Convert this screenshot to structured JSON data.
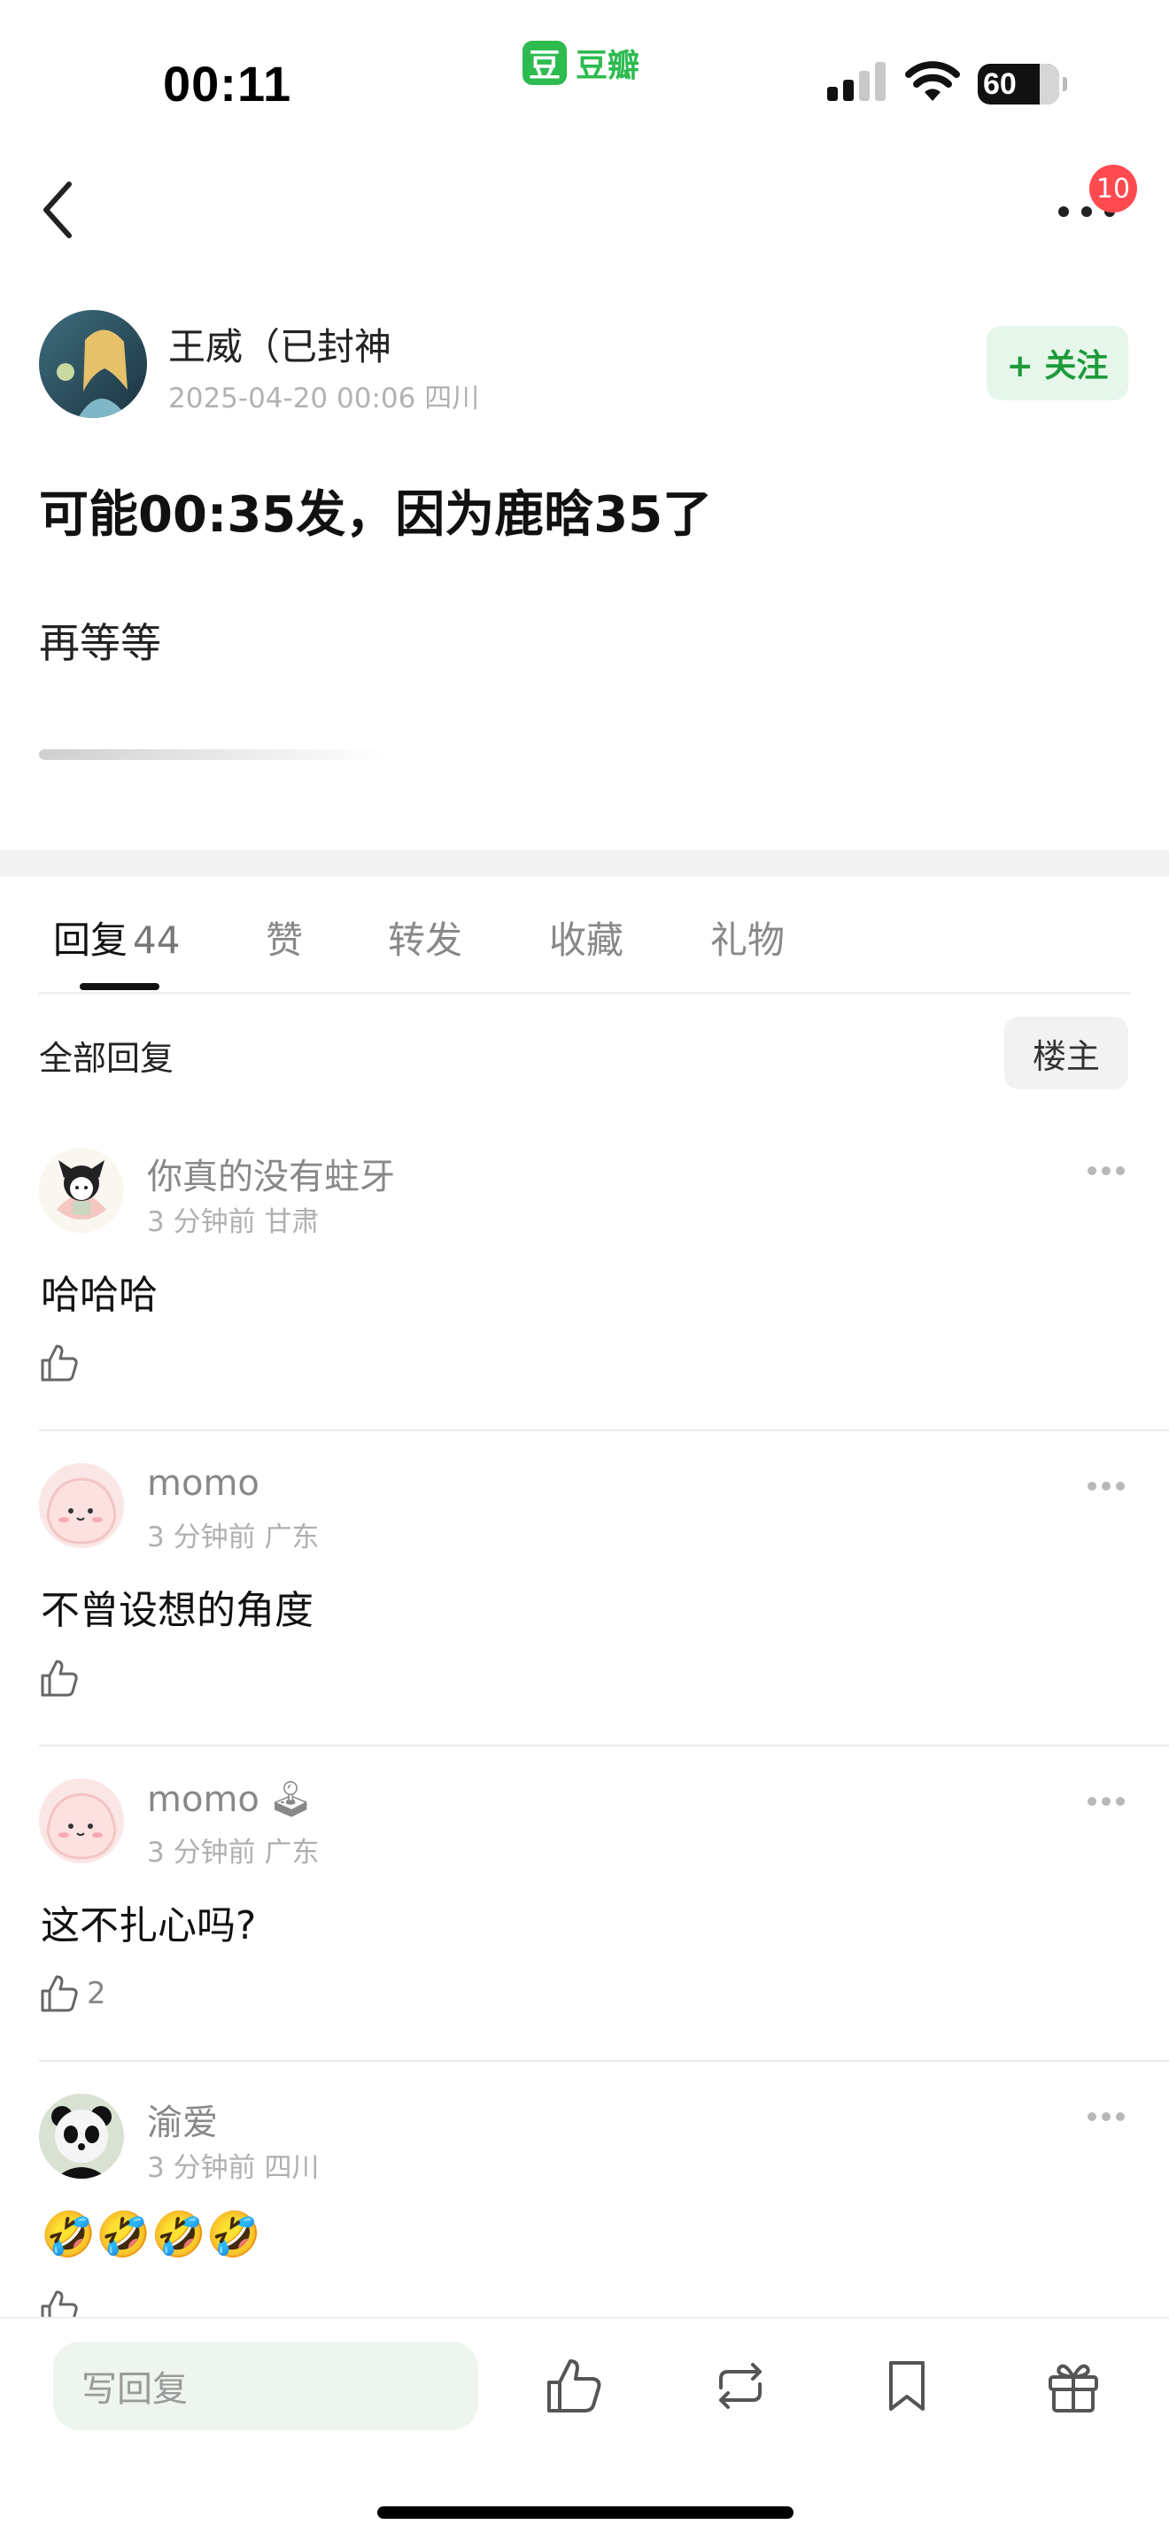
{
  "status_bar": {
    "time": "00:11",
    "app_name": "豆瓣",
    "app_logo_char": "豆",
    "battery": "60"
  },
  "nav": {
    "notification_count": "10"
  },
  "post": {
    "author": {
      "name": "王威（已封神",
      "date": "2025-04-20 00:06",
      "location": "四川"
    },
    "follow_label": "+ 关注",
    "title": "可能00:35发，因为鹿晗35了",
    "body": "再等等"
  },
  "tabs": [
    {
      "label": "回复",
      "count": "44"
    },
    {
      "label": "赞"
    },
    {
      "label": "转发"
    },
    {
      "label": "收藏"
    },
    {
      "label": "礼物"
    }
  ],
  "replies_header": {
    "title": "全部回复",
    "filter": "楼主"
  },
  "comments": [
    {
      "name": "你真的没有蛀牙",
      "time": "3 分钟前",
      "location": "甘肃",
      "text": "哈哈哈",
      "likes": ""
    },
    {
      "name": "momo",
      "time": "3 分钟前",
      "location": "广东",
      "text": "不曾设想的角度",
      "likes": ""
    },
    {
      "name": "momo",
      "badge": "🕹",
      "time": "3 分钟前",
      "location": "广东",
      "text": "这不扎心吗?",
      "likes": "2"
    },
    {
      "name": "渝爱",
      "time": "3 分钟前",
      "location": "四川",
      "text": "🤣🤣🤣🤣",
      "likes": ""
    }
  ],
  "bottom_bar": {
    "reply_placeholder": "写回复"
  },
  "colors": {
    "brand_green": "#2dbb4f",
    "follow_green": "#1d9a3a",
    "badge_red": "#ff4a50"
  }
}
